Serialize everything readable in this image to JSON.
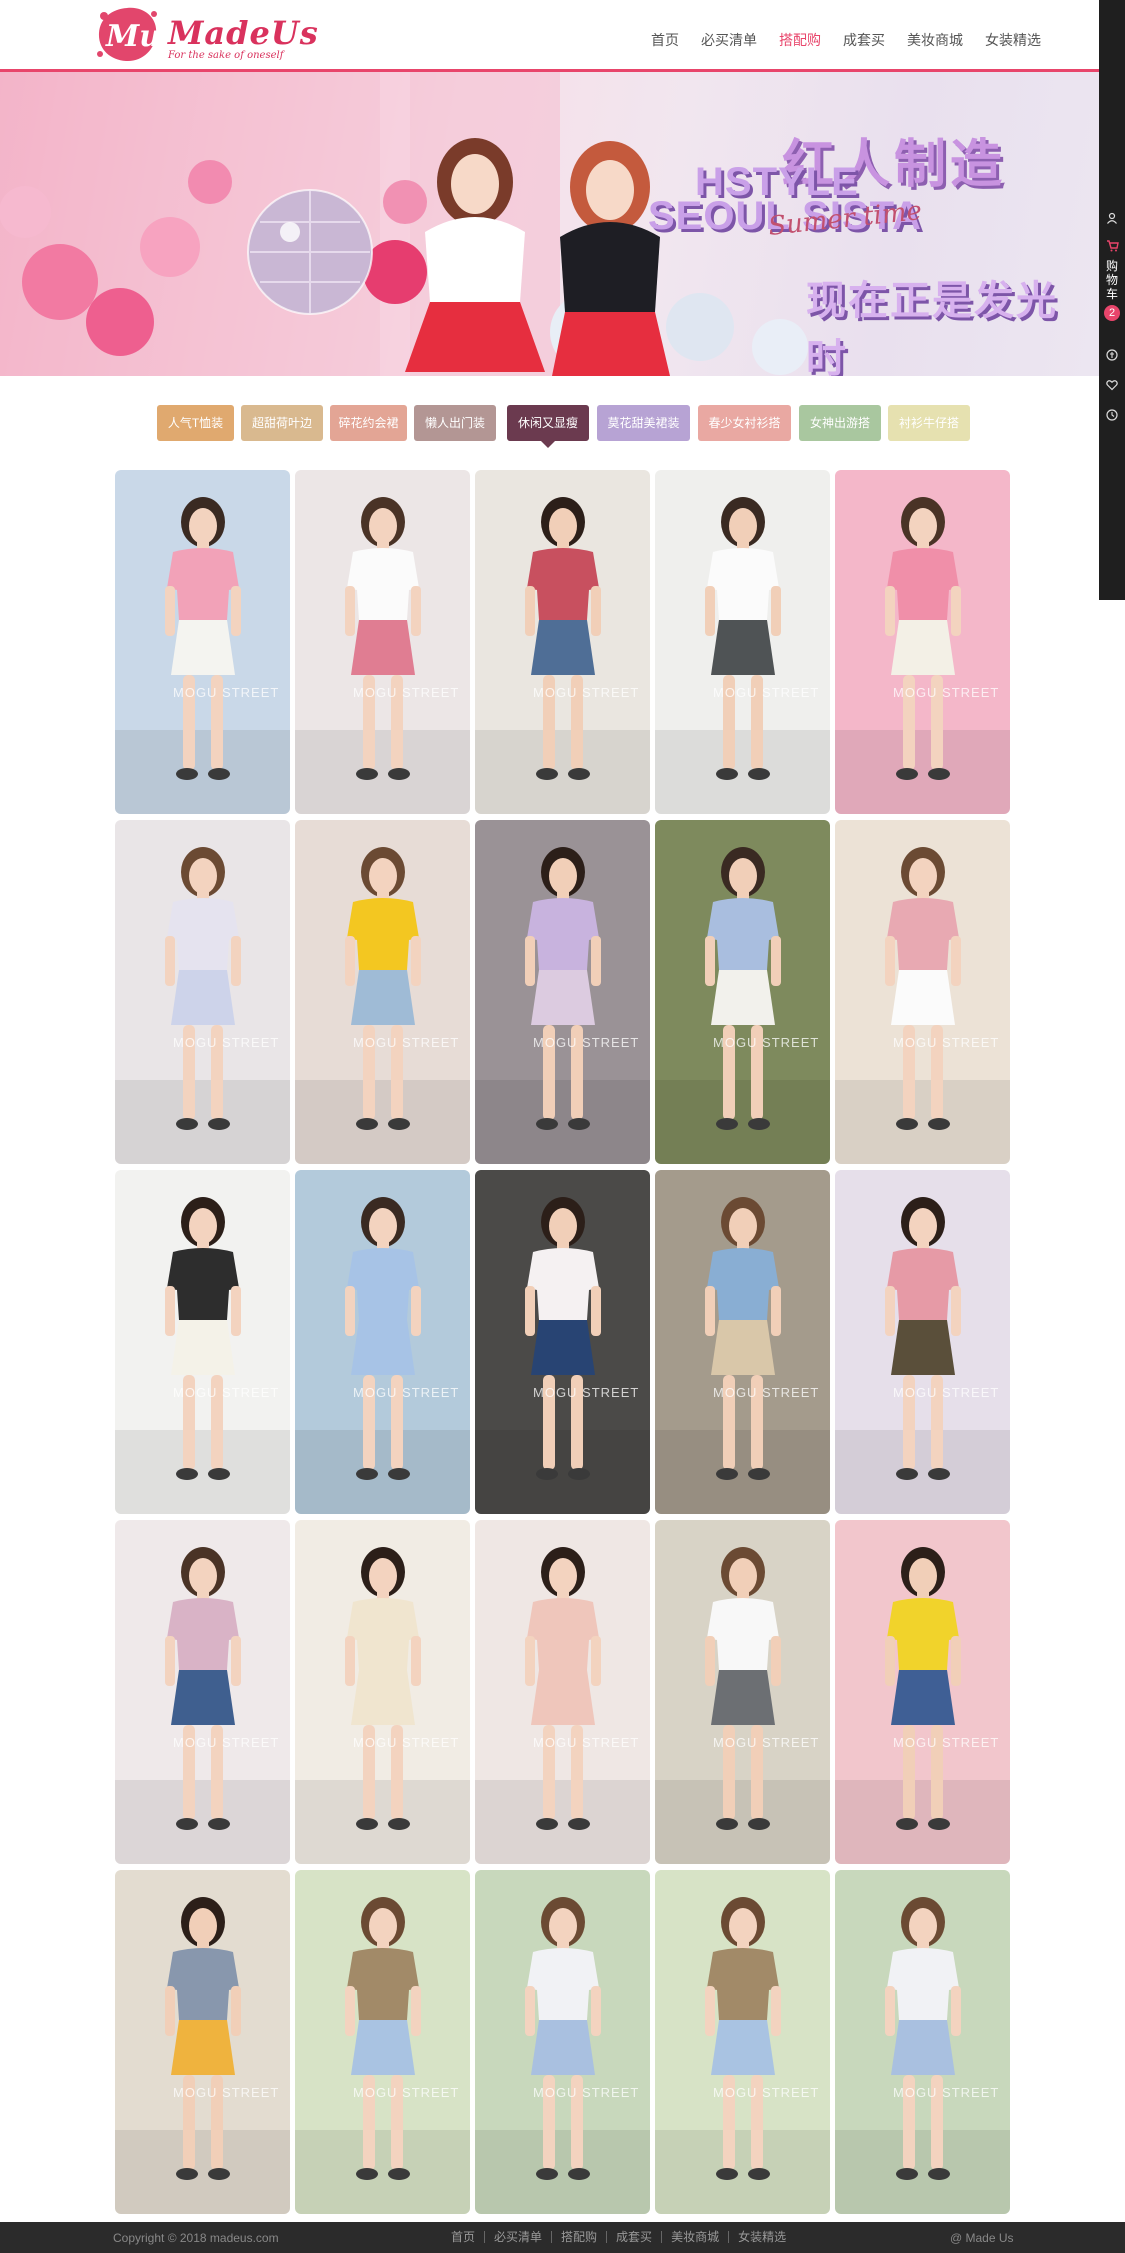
{
  "header": {
    "logo_name": "MadeUs",
    "logo_tagline": "For the sake of oneself",
    "brand_color": "#e8456b",
    "nav": [
      {
        "label": "首页",
        "active": false
      },
      {
        "label": "必买清单",
        "active": false
      },
      {
        "label": "搭配购",
        "active": true
      },
      {
        "label": "成套买",
        "active": false
      },
      {
        "label": "美妆商城",
        "active": false
      },
      {
        "label": "女装精选",
        "active": false
      }
    ]
  },
  "banner": {
    "line1": "红人制造",
    "line2": "HSTYLE",
    "line3": "SEOUL SISTA",
    "script": "Sumer time",
    "line4": "现在正是发光时"
  },
  "sidebar": {
    "icons": [
      "user-icon",
      "cart-icon",
      "coin-icon",
      "heart-icon",
      "clock-icon"
    ],
    "cart_label": "购物车",
    "cart_count": "2"
  },
  "tabs": [
    {
      "label": "人气T恤装",
      "color": "#e0a96f",
      "active": false
    },
    {
      "label": "超甜荷叶边",
      "color": "#d9b98f",
      "active": false
    },
    {
      "label": "碎花约会裙",
      "color": "#e3a595",
      "active": false
    },
    {
      "label": "懒人出门装",
      "color": "#b39694",
      "active": false
    },
    {
      "label": "休闲又显瘦",
      "color": "#6b3a4f",
      "active": true
    },
    {
      "label": "莫花甜美裙装",
      "color": "#b7a3d4",
      "active": false
    },
    {
      "label": "春少女衬衫搭",
      "color": "#e9a8a2",
      "active": false
    },
    {
      "label": "女神出游搭",
      "color": "#a9c79f",
      "active": false
    },
    {
      "label": "衬衫牛仔搭",
      "color": "#e6e1b0",
      "active": false
    }
  ],
  "grid": {
    "watermark": "MOGU STREET",
    "items": [
      {
        "name": "outfit-1",
        "bg": "#c9d8e8",
        "top": "#f2a2b8",
        "bottom": "#f4f4f0",
        "skin": "#f3d3bf",
        "hair": "#3a2a22"
      },
      {
        "name": "outfit-2",
        "bg": "#ece6e6",
        "top": "#fbfbfb",
        "bottom": "#e07d92",
        "skin": "#f3d3bf",
        "hair": "#4a3326"
      },
      {
        "name": "outfit-3",
        "bg": "#eae6e0",
        "top": "#c8505f",
        "bottom": "#4f6e96",
        "skin": "#f1cfb8",
        "hair": "#2c1f19"
      },
      {
        "name": "outfit-4",
        "bg": "#efefed",
        "top": "#fbfbfb",
        "bottom": "#4f5355",
        "skin": "#f1cfb8",
        "hair": "#3a2a22"
      },
      {
        "name": "outfit-5",
        "bg": "#f4b7c9",
        "top": "#f08fa9",
        "bottom": "#f3f0e6",
        "skin": "#f3d3bf",
        "hair": "#4a3326"
      },
      {
        "name": "outfit-6",
        "bg": "#e9e5e7",
        "top": "#e5e3ef",
        "bottom": "#cdd3ea",
        "skin": "#f3d3bf",
        "hair": "#6b4a33"
      },
      {
        "name": "outfit-7",
        "bg": "#e7dcd6",
        "top": "#f3c721",
        "bottom": "#9fbbd6",
        "skin": "#f3d3bf",
        "hair": "#6b4a33"
      },
      {
        "name": "outfit-8",
        "bg": "#9a9296",
        "top": "#c8b3de",
        "bottom": "#dccbe0",
        "skin": "#f1cfb8",
        "hair": "#2c1f19"
      },
      {
        "name": "outfit-9",
        "bg": "#7e8a5d",
        "top": "#a9bedf",
        "bottom": "#f2f1ec",
        "skin": "#f1cfb8",
        "hair": "#3a2a22"
      },
      {
        "name": "outfit-10",
        "bg": "#ece2d6",
        "top": "#e8a9b2",
        "bottom": "#fbfbfb",
        "skin": "#f3d3bf",
        "hair": "#6b4a33"
      },
      {
        "name": "outfit-11",
        "bg": "#f2f2f0",
        "top": "#2d2d2d",
        "bottom": "#f4f2e8",
        "skin": "#f3d3bf",
        "hair": "#2c1f19"
      },
      {
        "name": "outfit-12",
        "bg": "#b3cadb",
        "top": "#a7c3e6",
        "bottom": "#a7c3e6",
        "skin": "#f3d3bf",
        "hair": "#3a2a22"
      },
      {
        "name": "outfit-13",
        "bg": "#4b4a48",
        "top": "#f5f1f2",
        "bottom": "#284473",
        "skin": "#f1cfb8",
        "hair": "#2c1f19"
      },
      {
        "name": "outfit-14",
        "bg": "#a49b8c",
        "top": "#89aed3",
        "bottom": "#d9c7a9",
        "skin": "#f1cfb8",
        "hair": "#6b4a33"
      },
      {
        "name": "outfit-15",
        "bg": "#e6dfea",
        "top": "#e69aa6",
        "bottom": "#5a4f3a",
        "skin": "#f3d3bf",
        "hair": "#2c1f19"
      },
      {
        "name": "outfit-16",
        "bg": "#efe9ea",
        "top": "#d9b3c6",
        "bottom": "#3f5f8f",
        "skin": "#f3d3bf",
        "hair": "#4a3326"
      },
      {
        "name": "outfit-17",
        "bg": "#f1ece4",
        "top": "#f0e5cf",
        "bottom": "#f0e5cf",
        "skin": "#f3d3bf",
        "hair": "#2c1f19"
      },
      {
        "name": "outfit-18",
        "bg": "#efe7e4",
        "top": "#efc6bb",
        "bottom": "#efc6bb",
        "skin": "#f3d3bf",
        "hair": "#2c1f19"
      },
      {
        "name": "outfit-19",
        "bg": "#d8d3c6",
        "top": "#f8f8f8",
        "bottom": "#6c6f73",
        "skin": "#f1cfb8",
        "hair": "#6b4a33"
      },
      {
        "name": "outfit-20",
        "bg": "#f2c6cc",
        "top": "#f1d32b",
        "bottom": "#3f5f95",
        "skin": "#f1cfb8",
        "hair": "#2c1f19"
      },
      {
        "name": "outfit-21",
        "bg": "#e3dcd0",
        "top": "#8897ad",
        "bottom": "#efb33e",
        "skin": "#f1cfb8",
        "hair": "#2c1f19"
      },
      {
        "name": "outfit-22",
        "bg": "#d7e3c6",
        "top": "#a28a68",
        "bottom": "#a9c3e2",
        "skin": "#f3d3bf",
        "hair": "#6b4a33"
      },
      {
        "name": "outfit-23",
        "bg": "#c8d8bc",
        "top": "#f1f2f5",
        "bottom": "#a9c0e0",
        "skin": "#f3d3bf",
        "hair": "#6b4a33"
      },
      {
        "name": "outfit-24",
        "bg": "#d7e3c6",
        "top": "#a28a68",
        "bottom": "#a9c3e2",
        "skin": "#f3d3bf",
        "hair": "#6b4a33"
      },
      {
        "name": "outfit-25",
        "bg": "#c8d8bc",
        "top": "#f1f2f5",
        "bottom": "#a9c0e0",
        "skin": "#f3d3bf",
        "hair": "#6b4a33"
      }
    ]
  },
  "footer": {
    "copyright": "Copyright © 2018 madeus.com",
    "links": [
      "首页",
      "必买清单",
      "搭配购",
      "成套买",
      "美妆商城",
      "女装精选"
    ],
    "brand": "@ Made Us"
  }
}
